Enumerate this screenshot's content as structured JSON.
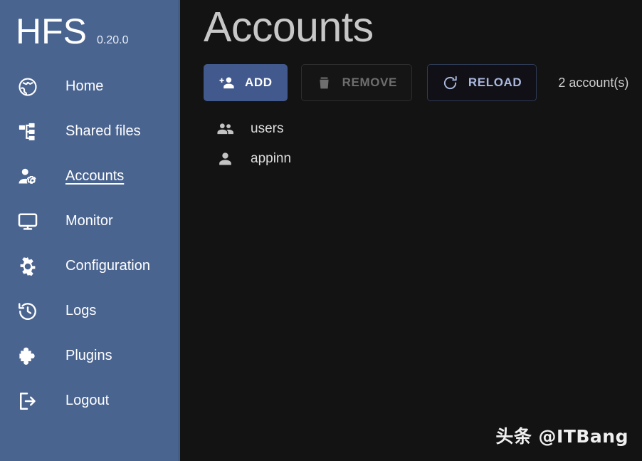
{
  "sidebar": {
    "brand": {
      "name": "HFS",
      "version": "0.20.0"
    },
    "items": [
      {
        "label": "Home",
        "icon": "globe-icon",
        "active": false
      },
      {
        "label": "Shared files",
        "icon": "file-tree-icon",
        "active": false
      },
      {
        "label": "Accounts",
        "icon": "manage-accounts-icon",
        "active": true
      },
      {
        "label": "Monitor",
        "icon": "monitor-icon",
        "active": false
      },
      {
        "label": "Configuration",
        "icon": "gear-icon",
        "active": false
      },
      {
        "label": "Logs",
        "icon": "history-icon",
        "active": false
      },
      {
        "label": "Plugins",
        "icon": "puzzle-icon",
        "active": false
      },
      {
        "label": "Logout",
        "icon": "logout-icon",
        "active": false
      }
    ]
  },
  "main": {
    "title": "Accounts",
    "toolbar": {
      "add_label": "ADD",
      "remove_label": "REMOVE",
      "reload_label": "RELOAD",
      "count_label": "2 account(s)"
    },
    "accounts": [
      {
        "name": "users",
        "icon": "group-icon"
      },
      {
        "name": "appinn",
        "icon": "person-icon"
      }
    ]
  },
  "watermark": {
    "text": "头条 @ITBang"
  },
  "colors": {
    "sidebar_bg": "#4a6490",
    "main_bg": "#131313",
    "accent": "#41598c",
    "outline_text": "#aab8dd",
    "disabled_text": "#6e6e6e",
    "title_text": "#c7c7c7"
  }
}
